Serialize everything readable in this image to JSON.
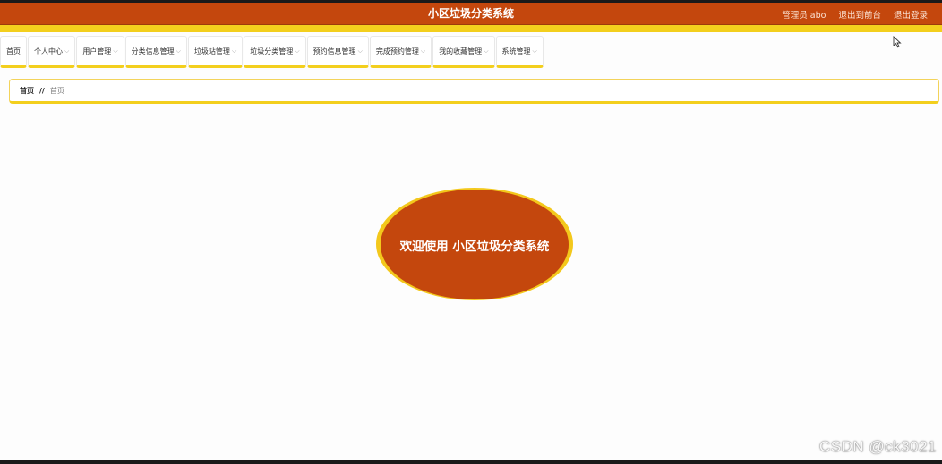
{
  "header": {
    "title": "小区垃圾分类系统",
    "user_label": "管理员 abo",
    "back_to_front": "退出到前台",
    "logout": "退出登录"
  },
  "nav": {
    "items": [
      {
        "label": "首页",
        "has_dropdown": false
      },
      {
        "label": "个人中心",
        "has_dropdown": true
      },
      {
        "label": "用户管理",
        "has_dropdown": true
      },
      {
        "label": "分类信息管理",
        "has_dropdown": true
      },
      {
        "label": "垃圾站管理",
        "has_dropdown": true
      },
      {
        "label": "垃圾分类管理",
        "has_dropdown": true
      },
      {
        "label": "预约信息管理",
        "has_dropdown": true
      },
      {
        "label": "完成预约管理",
        "has_dropdown": true
      },
      {
        "label": "我的收藏管理",
        "has_dropdown": true
      },
      {
        "label": "系统管理",
        "has_dropdown": true
      }
    ],
    "caret_icon": "chevron-down-icon"
  },
  "breadcrumb": {
    "home": "首页",
    "separator": "//",
    "current": "首页"
  },
  "main": {
    "welcome": "欢迎使用 小区垃圾分类系统"
  },
  "watermark": "CSDN @ck3021",
  "colors": {
    "header_bg": "#c4470d",
    "accent_yellow": "#f3cf1d",
    "welcome_bg": "#c4470d"
  }
}
